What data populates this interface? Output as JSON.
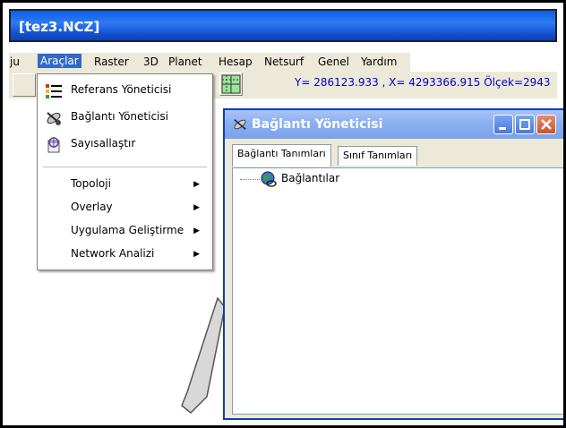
{
  "window": {
    "title": "[tez3.NCZ]"
  },
  "menubar": {
    "items": [
      {
        "label": "ju"
      },
      {
        "label": "Araçlar"
      },
      {
        "label": "Raster"
      },
      {
        "label": "3D"
      },
      {
        "label": "Planet"
      },
      {
        "label": "Hesap"
      },
      {
        "label": "Netsurf"
      },
      {
        "label": "Genel"
      },
      {
        "label": "Yardım"
      }
    ]
  },
  "statusline": {
    "coords": "Y= 286123.933 , X= 4293366.915 Ölçek=2943"
  },
  "dropdown": {
    "items": [
      {
        "label": "Referans Yöneticisi",
        "icon": "list-icon"
      },
      {
        "label": "Bağlantı Yöneticisi",
        "icon": "satellite-icon"
      },
      {
        "label": "Sayısallaştır",
        "icon": "digitize-icon"
      },
      {
        "label": "Topoloji",
        "submenu": true
      },
      {
        "label": "Overlay",
        "submenu": true
      },
      {
        "label": "Uygulama Geliştirme",
        "submenu": true
      },
      {
        "label": "Network Analizi",
        "submenu": true
      }
    ]
  },
  "connection_window": {
    "title": "Bağlantı Yöneticisi",
    "tabs": [
      {
        "label": "Bağlantı Tanımları"
      },
      {
        "label": "Sınıf Tanımları"
      }
    ],
    "tree_root": "Bağlantılar"
  },
  "colors": {
    "titlebar": "#1553d3",
    "menu_highlight": "#316ac5",
    "coords_text": "#0000cc",
    "chrome": "#ece9d8"
  }
}
